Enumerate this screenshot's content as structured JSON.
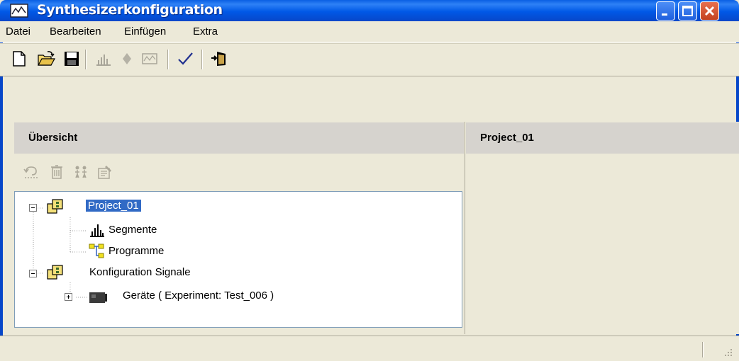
{
  "window": {
    "title": "Synthesizerkonfiguration",
    "colors": {
      "titlebar": "#0058e6",
      "selection": "#316ac5",
      "face": "#ece9d8"
    }
  },
  "menu": {
    "items": [
      "Datei",
      "Bearbeiten",
      "Einfügen",
      "Extra"
    ]
  },
  "toolbar": {
    "icons": [
      "new-document-icon",
      "open-folder-icon",
      "save-disk-icon",
      "segments-chart-icon",
      "diamond-icon",
      "signal-grid-icon",
      "checkmark-icon",
      "exit-door-icon"
    ]
  },
  "left_pane": {
    "header": "Übersicht",
    "sub_toolbar_icons": [
      "undo-icon",
      "trash-icon",
      "people-icon",
      "properties-icon"
    ]
  },
  "right_pane": {
    "header": "Project_01"
  },
  "tree": {
    "nodes": [
      {
        "label": "Project_01",
        "icon": "project-folder-icon",
        "expanded": true,
        "selected": true
      },
      {
        "label": "Segmente",
        "icon": "segments-chart-icon"
      },
      {
        "label": "Programme",
        "icon": "program-tree-icon"
      },
      {
        "label": "Konfiguration Signale",
        "icon": "project-folder-icon",
        "expanded": true
      },
      {
        "label": "Geräte ( Experiment: Test_006 )",
        "icon": "device-icon",
        "expanded": false
      }
    ]
  }
}
